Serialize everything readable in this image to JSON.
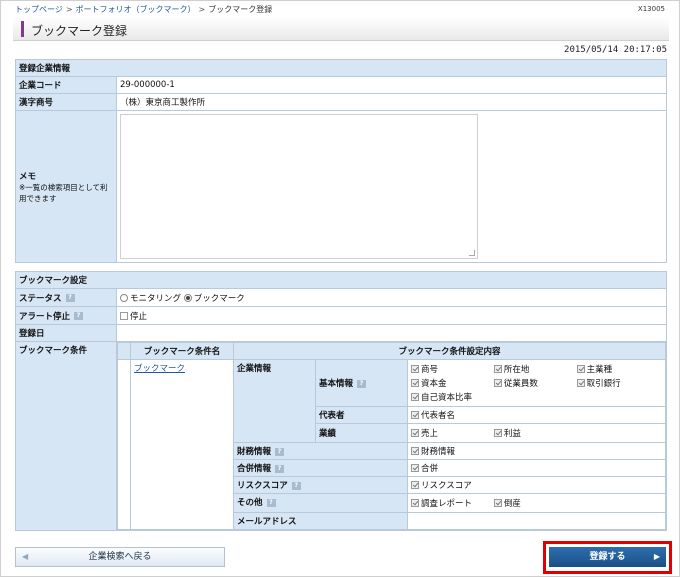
{
  "breadcrumb": {
    "home": "トップページ",
    "portfolio": "ポートフォリオ（ブックマーク）",
    "current": "ブックマーク登録",
    "sep": ">"
  },
  "screen_id": "X13005",
  "page_title": "ブックマーク登録",
  "timestamp": "2015/05/14 20:17:05",
  "company": {
    "section": "登録企業情報",
    "code_label": "企業コード",
    "code": "29-000000-1",
    "name_label": "漢字商号",
    "name": "（株）東京商工製作所",
    "memo_label": "メモ",
    "memo_note": "※一覧の検索項目として利用できます",
    "memo_value": ""
  },
  "bookmark": {
    "section": "ブックマーク設定",
    "status_label": "ステータス",
    "status_options": [
      "モニタリング",
      "ブックマーク"
    ],
    "status_selected": "ブックマーク",
    "alert_label": "アラート停止",
    "alert_option": "停止",
    "date_label": "登録日",
    "date_value": "",
    "cond_label": "ブックマーク条件",
    "cond_name_header": "ブックマーク条件名",
    "cond_detail_header": "ブックマーク条件設定内容",
    "cond_name": "ブックマーク",
    "groups": {
      "corp": "企業情報",
      "basic": "基本情報",
      "basic_items": [
        "商号",
        "所在地",
        "主業種",
        "資本金",
        "従業員数",
        "取引銀行",
        "自己資本比率"
      ],
      "rep": "代表者",
      "rep_items": [
        "代表者名"
      ],
      "perf": "業績",
      "perf_items": [
        "売上",
        "利益"
      ],
      "fin": "財務情報",
      "fin_items": [
        "財務情報"
      ],
      "merge": "合併情報",
      "merge_items": [
        "合併"
      ],
      "risk": "リスクスコア",
      "risk_items": [
        "リスクスコア"
      ],
      "other": "その他",
      "other_items": [
        "調査レポート",
        "倒産"
      ],
      "mail": "メールアドレス"
    }
  },
  "buttons": {
    "back": "企業検索へ戻る",
    "register": "登録する"
  },
  "icons": {
    "help": "help-icon",
    "back_arrow": "◀",
    "next_arrow": "▶"
  }
}
